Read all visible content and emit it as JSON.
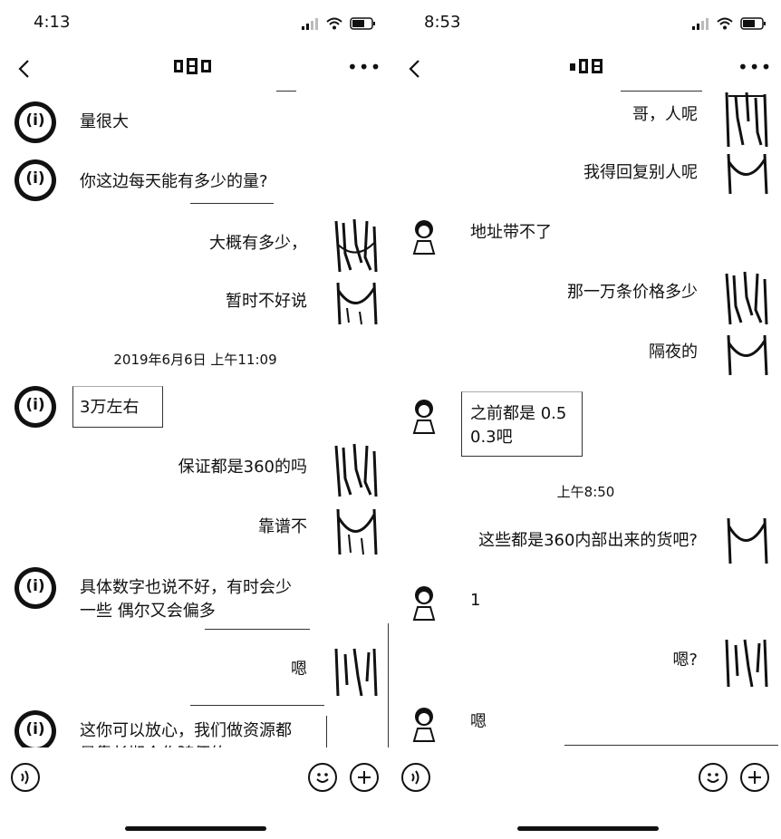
{
  "left": {
    "status": {
      "time": "4:13"
    },
    "messages": {
      "m1": "量很大",
      "m2": "你这边每天能有多少的量?",
      "m3": "大概有多少，",
      "m4": "暂时不好说",
      "ts": "2019年6月6日 上午11:09",
      "m5": "3万左右",
      "m6": "保证都是360的吗",
      "m7": "靠谱不",
      "m8": "具体数字也说不好，有时会少\n一些 偶尔又会偏多",
      "m9": "嗯",
      "m10": "这你可以放心，我们做资源都\n是靠长期合作随便的"
    }
  },
  "right": {
    "status": {
      "time": "8:53"
    },
    "messages": {
      "m1": "哥，人呢",
      "m2": "我得回复别人呢",
      "m3": "地址带不了",
      "m4": "那一万条价格多少",
      "m5": "隔夜的",
      "m6": "之前都是 0.5\n0.3吧",
      "ts": "上午8:50",
      "m7": "这些都是360内部出来的货吧?",
      "m8": "1",
      "m9": "嗯?",
      "m10": "嗯"
    }
  },
  "icons": {
    "back": "chevron-left-icon",
    "more": "more-icon",
    "voice": "voice-icon",
    "emoji": "emoji-icon",
    "add": "plus-icon"
  }
}
